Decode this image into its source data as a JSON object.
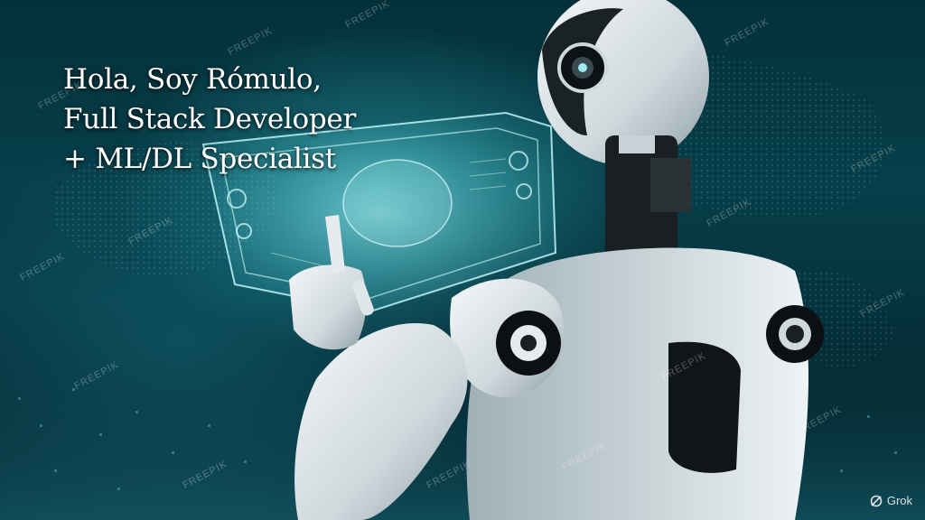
{
  "headline": {
    "line1": "Hola, Soy Rómulo,",
    "line2": "Full Stack Developer",
    "line3": "+ ML/DL Specialist"
  },
  "badge": {
    "label": "Grok",
    "icon": "grok-logo-icon"
  },
  "colors": {
    "background_dark": "#021a22",
    "accent_teal": "#3cc8d2",
    "robot_white": "#e8eef0",
    "text": "#ffffff"
  }
}
